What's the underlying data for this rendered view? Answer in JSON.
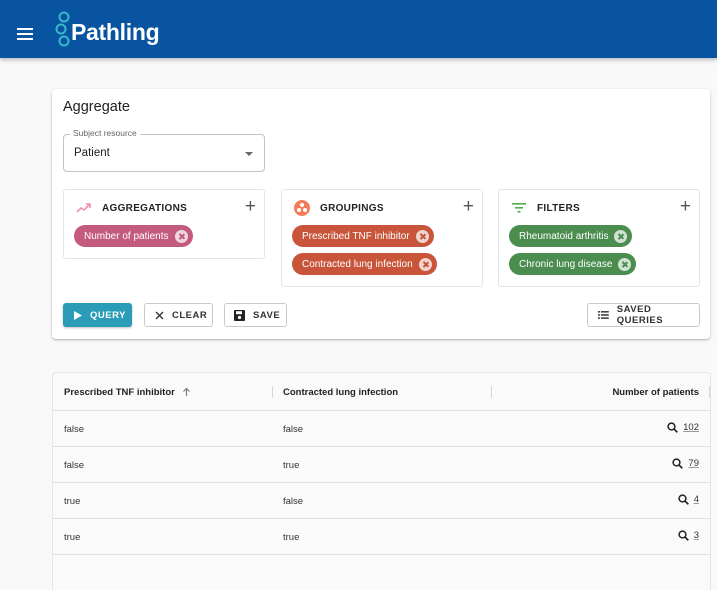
{
  "appbar": {
    "title": "Pathling",
    "menu_icon": "menu-icon",
    "brand_color": "#0854a0"
  },
  "aggregate": {
    "title": "Aggregate",
    "subject_resource": {
      "label": "Subject resource",
      "value": "Patient"
    },
    "panels": {
      "aggregations": {
        "title": "AGGREGATIONS",
        "icon": "trending-up-icon",
        "color": "#c45b7d",
        "chips": [
          "Number of patients"
        ]
      },
      "groupings": {
        "title": "GROUPINGS",
        "icon": "workspaces-icon",
        "color": "#c8553a",
        "chips": [
          "Prescribed TNF inhibitor",
          "Contracted lung infection"
        ]
      },
      "filters": {
        "title": "FILTERS",
        "icon": "filter-icon",
        "color": "#4a8d4f",
        "chips": [
          "Rheumatoid arthritis",
          "Chronic lung disease"
        ]
      }
    },
    "buttons": {
      "query": "QUERY",
      "clear": "CLEAR",
      "save": "SAVE",
      "saved_queries": "SAVED QUERIES"
    },
    "primary_color": "#2a9cb8"
  },
  "results": {
    "columns": [
      "Prescribed TNF inhibitor",
      "Contracted lung infection",
      "Number of patients"
    ],
    "sort_indicator": "arrow-up-icon",
    "rows": [
      {
        "tnf": "false",
        "lung": "false",
        "count": "102"
      },
      {
        "tnf": "false",
        "lung": "true",
        "count": "79"
      },
      {
        "tnf": "true",
        "lung": "false",
        "count": "4"
      },
      {
        "tnf": "true",
        "lung": "true",
        "count": "3"
      }
    ]
  }
}
